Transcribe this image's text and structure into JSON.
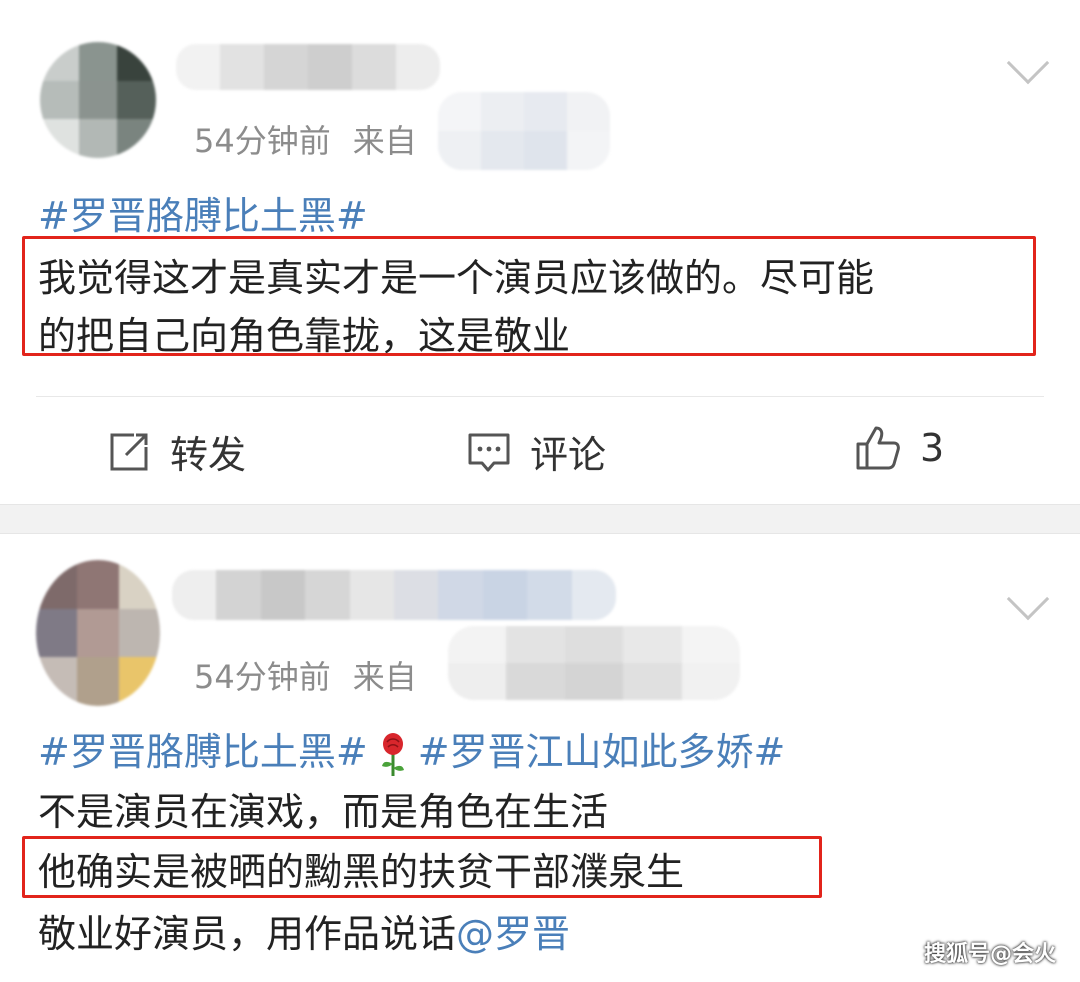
{
  "posts": [
    {
      "time": "54分钟前",
      "source_label": "来自",
      "tags": [
        "#罗晋胳膊比土黑#"
      ],
      "body_lines": [
        "我觉得这才是真实才是一个演员应该做的。尽可能",
        "的把自己向角色靠拢，这是敬业"
      ],
      "actions": {
        "repost": "转发",
        "comment": "评论",
        "like_count": "3"
      }
    },
    {
      "time": "54分钟前",
      "source_label": "来自",
      "tag_line": {
        "tag1": "#罗晋胳膊比土黑#",
        "tag2": "#罗晋江山如此多娇#"
      },
      "lines": [
        "不是演员在演戏，而是角色在生活",
        "他确实是被晒的黝黑的扶贫干部濮泉生",
        "敬业好演员，用作品说话"
      ],
      "mention": "@罗晋"
    }
  ],
  "watermark": "搜狐号@会火",
  "colors": {
    "link": "#4a7fb9",
    "highlight_box": "#e2241b",
    "meta_text": "#8c8c8c",
    "separator": "#f2f2f2"
  },
  "icons": [
    "repost-icon",
    "comment-icon",
    "like-icon",
    "chevron-down-icon",
    "rose-emoji-icon"
  ]
}
